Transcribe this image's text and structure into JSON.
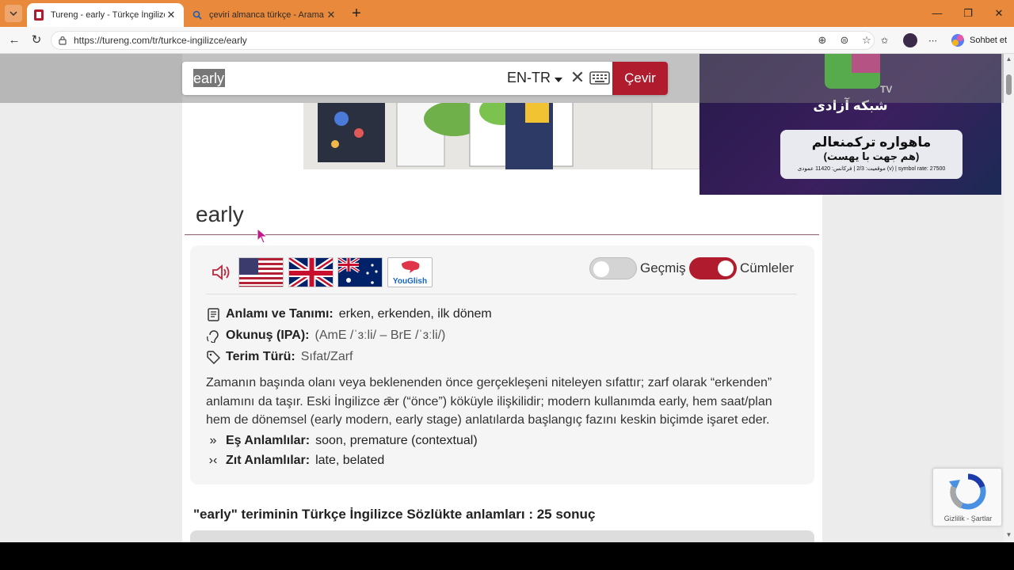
{
  "browser": {
    "tabs": [
      {
        "title": "Tureng - early - Türkçe İngilizce Sö",
        "active": true
      },
      {
        "title": "çeviri almanca türkçe - Arama",
        "active": false
      }
    ],
    "url": "https://tureng.com/tr/turkce-ingilizce/early",
    "copilot_label": "Sohbet et"
  },
  "search": {
    "value": "early",
    "language": "EN-TR",
    "submit_label": "Çevir"
  },
  "ad": {
    "tv_label": "TV",
    "channel_name": "شبکه آزادی",
    "box_title": "ماهواره ترکمنعالم",
    "box_subtitle": "(هم جهت با یهست)",
    "box_footer": "موقعیت: 2/3 | فرکانس: 11420 عمودی (v) | symbol rate: 27500"
  },
  "entry": {
    "word": "early",
    "toggles": {
      "history_label": "Geçmiş",
      "history_on": false,
      "sentences_label": "Cümleler",
      "sentences_on": true
    },
    "youglish_label": "YouGlish",
    "meaning_label": "Anlamı ve Tanımı:",
    "meanings": "erken, erkenden, ilk dönem",
    "pronunciation_label": "Okunuş (IPA):",
    "pronunciation": "(AmE /ˈɜːli/ – BrE /ˈɜːli/)",
    "term_type_label": "Terim Türü:",
    "term_type": "Sıfat/Zarf",
    "description": "Zamanın başında olanı veya beklenenden önce gerçekleşeni niteleyen sıfattır; zarf olarak “erkenden” anlamını da taşır. Eski İngilizce ǣr (“önce”) köküyle ilişkilidir; modern kullanımda early, hem saat/plan hem de dönemsel (early modern, early stage) anlatılarda başlangıç fazını keskin biçimde işaret eder.",
    "synonyms_label": "Eş Anlamlılar:",
    "synonyms": "soon, premature (contextual)",
    "antonyms_label": "Zıt Anlamlılar:",
    "antonyms": "late, belated"
  },
  "results": {
    "heading": "\"early\" teriminin Türkçe İngilizce Sözlükte anlamları : 25 sonuç"
  },
  "recaptcha": {
    "privacy": "Gizlilik",
    "separator": " - ",
    "terms": "Şartlar"
  },
  "colors": {
    "accent": "#b01c2e",
    "tabbar": "#e8893b"
  }
}
